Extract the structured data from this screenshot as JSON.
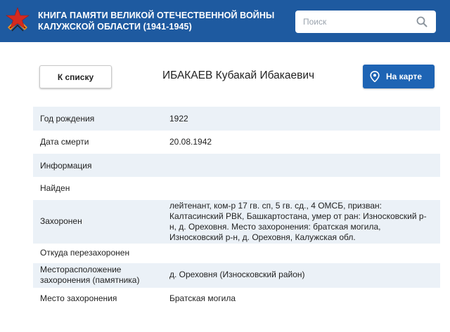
{
  "header": {
    "title_line1": "КНИГА ПАМЯТИ ВЕЛИКОЙ ОТЕЧЕСТВЕННОЙ ВОЙНЫ",
    "title_line2": "КАЛУЖСКОЙ ОБЛАСТИ (1941-1945)",
    "search_placeholder": "Поиск",
    "colors": {
      "bar": "#1e5aa0",
      "star": "#d42a20",
      "ribbon_orange": "#f08c1e"
    }
  },
  "toolbar": {
    "back_label": "К списку",
    "person_name": "ИБАКАЕВ Кубакай Ибакаевич",
    "map_label": "На карте",
    "map_button_color": "#1e64b4"
  },
  "details": [
    {
      "label": "Год рождения",
      "value": "1922"
    },
    {
      "label": "Дата смерти",
      "value": "20.08.1942"
    },
    {
      "label": "Информация",
      "value": ""
    },
    {
      "label": "Найден",
      "value": ""
    },
    {
      "label": "Захоронен",
      "value_lines": [
        "лейтенант, ком-р 17 гв. сп, 5 гв. сд., 4 ОМСБ, призван:",
        "Калтасинский РВК, Башкартостана, умер от ран: Износковский р-",
        "н, д. Ореховня. Место захоронения: братская могила,",
        "Износковский р-н, д. Ореховня, Калужская обл."
      ]
    },
    {
      "label": "Откуда перезахоронен",
      "value": ""
    },
    {
      "label_lines": [
        "Месторасположение",
        "захоронения (памятника)"
      ],
      "value": "д. Ореховня (Износковский район)"
    },
    {
      "label": "Место захоронения",
      "value": "Братская могила"
    }
  ]
}
